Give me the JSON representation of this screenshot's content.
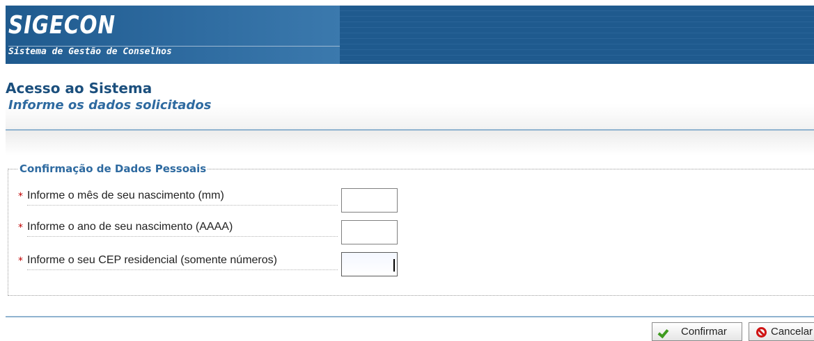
{
  "banner": {
    "app_title": "SIGECON",
    "app_subtitle": "Sistema de Gestão de Conselhos"
  },
  "header": {
    "title": "Acesso ao Sistema",
    "subtitle": "Informe os dados solicitados"
  },
  "form": {
    "legend": "Confirmação de Dados Pessoais",
    "required_marker": "*",
    "fields": [
      {
        "label": "Informe o mês de seu nascimento (mm)",
        "value": ""
      },
      {
        "label": "Informe o ano de seu nascimento (AAAA)",
        "value": ""
      },
      {
        "label": "Informe o seu CEP residencial (somente números)",
        "value": ""
      }
    ]
  },
  "buttons": {
    "confirm_label": "Confirmar",
    "cancel_label": "Cancelar",
    "confirm_icon": "check-icon",
    "cancel_icon": "ban-icon"
  },
  "colors": {
    "banner": "#1f5a8e",
    "title": "#1b4f7d",
    "accent": "#2e6aa0",
    "required": "#c00000"
  }
}
